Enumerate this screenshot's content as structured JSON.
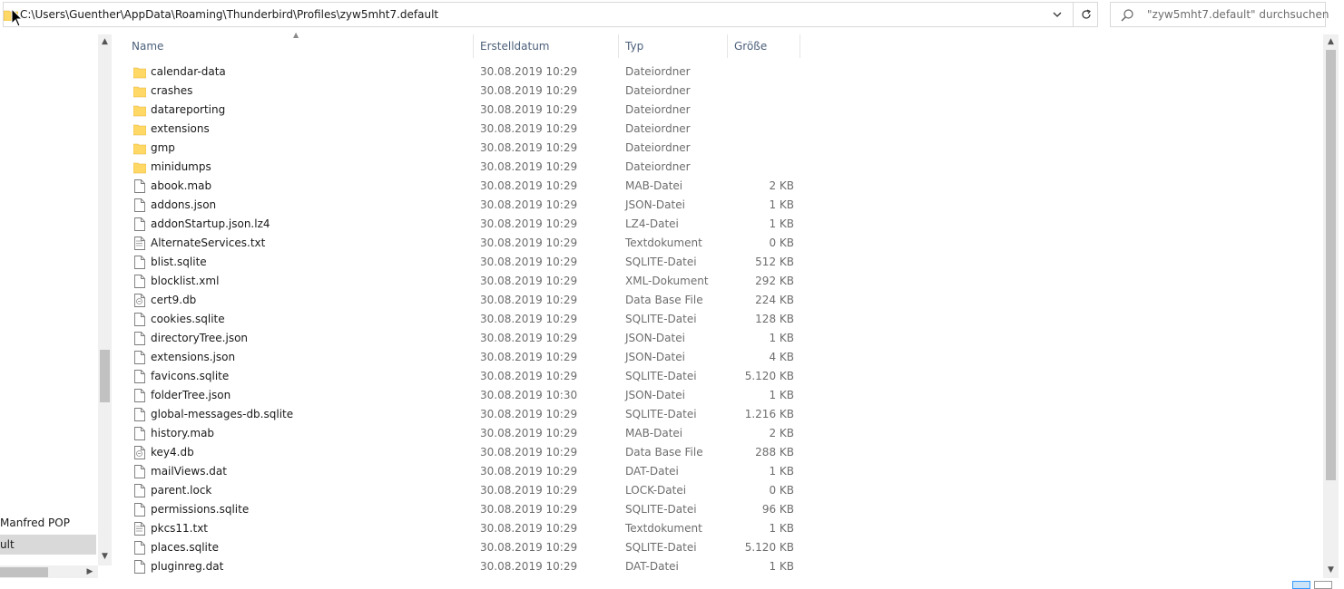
{
  "address": {
    "path": "C:\\Users\\Guenther\\AppData\\Roaming\\Thunderbird\\Profiles\\zyw5mht7.default",
    "dropdown_icon": "chevron-down-icon",
    "refresh_icon": "refresh-icon"
  },
  "search": {
    "placeholder": "\"zyw5mht7.default\" durchsuchen"
  },
  "nav": {
    "items": [
      {
        "label": "Manfred POP",
        "selected": false
      },
      {
        "label": "ult",
        "selected": true
      }
    ]
  },
  "columns": {
    "name": "Name",
    "date": "Erstelldatum",
    "type": "Typ",
    "size": "Größe"
  },
  "files": [
    {
      "name": "calendar-data",
      "date": "30.08.2019 10:29",
      "type": "Dateiordner",
      "size": "",
      "icon": "folder"
    },
    {
      "name": "crashes",
      "date": "30.08.2019 10:29",
      "type": "Dateiordner",
      "size": "",
      "icon": "folder"
    },
    {
      "name": "datareporting",
      "date": "30.08.2019 10:29",
      "type": "Dateiordner",
      "size": "",
      "icon": "folder"
    },
    {
      "name": "extensions",
      "date": "30.08.2019 10:29",
      "type": "Dateiordner",
      "size": "",
      "icon": "folder"
    },
    {
      "name": "gmp",
      "date": "30.08.2019 10:29",
      "type": "Dateiordner",
      "size": "",
      "icon": "folder"
    },
    {
      "name": "minidumps",
      "date": "30.08.2019 10:29",
      "type": "Dateiordner",
      "size": "",
      "icon": "folder"
    },
    {
      "name": "abook.mab",
      "date": "30.08.2019 10:29",
      "type": "MAB-Datei",
      "size": "2 KB",
      "icon": "file"
    },
    {
      "name": "addons.json",
      "date": "30.08.2019 10:29",
      "type": "JSON-Datei",
      "size": "1 KB",
      "icon": "file"
    },
    {
      "name": "addonStartup.json.lz4",
      "date": "30.08.2019 10:29",
      "type": "LZ4-Datei",
      "size": "1 KB",
      "icon": "file"
    },
    {
      "name": "AlternateServices.txt",
      "date": "30.08.2019 10:29",
      "type": "Textdokument",
      "size": "0 KB",
      "icon": "text"
    },
    {
      "name": "blist.sqlite",
      "date": "30.08.2019 10:29",
      "type": "SQLITE-Datei",
      "size": "512 KB",
      "icon": "file"
    },
    {
      "name": "blocklist.xml",
      "date": "30.08.2019 10:29",
      "type": "XML-Dokument",
      "size": "292 KB",
      "icon": "file"
    },
    {
      "name": "cert9.db",
      "date": "30.08.2019 10:29",
      "type": "Data Base File",
      "size": "224 KB",
      "icon": "db"
    },
    {
      "name": "cookies.sqlite",
      "date": "30.08.2019 10:29",
      "type": "SQLITE-Datei",
      "size": "128 KB",
      "icon": "file"
    },
    {
      "name": "directoryTree.json",
      "date": "30.08.2019 10:29",
      "type": "JSON-Datei",
      "size": "1 KB",
      "icon": "file"
    },
    {
      "name": "extensions.json",
      "date": "30.08.2019 10:29",
      "type": "JSON-Datei",
      "size": "4 KB",
      "icon": "file"
    },
    {
      "name": "favicons.sqlite",
      "date": "30.08.2019 10:29",
      "type": "SQLITE-Datei",
      "size": "5.120 KB",
      "icon": "file"
    },
    {
      "name": "folderTree.json",
      "date": "30.08.2019 10:30",
      "type": "JSON-Datei",
      "size": "1 KB",
      "icon": "file"
    },
    {
      "name": "global-messages-db.sqlite",
      "date": "30.08.2019 10:29",
      "type": "SQLITE-Datei",
      "size": "1.216 KB",
      "icon": "file"
    },
    {
      "name": "history.mab",
      "date": "30.08.2019 10:29",
      "type": "MAB-Datei",
      "size": "2 KB",
      "icon": "file"
    },
    {
      "name": "key4.db",
      "date": "30.08.2019 10:29",
      "type": "Data Base File",
      "size": "288 KB",
      "icon": "db"
    },
    {
      "name": "mailViews.dat",
      "date": "30.08.2019 10:29",
      "type": "DAT-Datei",
      "size": "1 KB",
      "icon": "file"
    },
    {
      "name": "parent.lock",
      "date": "30.08.2019 10:29",
      "type": "LOCK-Datei",
      "size": "0 KB",
      "icon": "file"
    },
    {
      "name": "permissions.sqlite",
      "date": "30.08.2019 10:29",
      "type": "SQLITE-Datei",
      "size": "96 KB",
      "icon": "file"
    },
    {
      "name": "pkcs11.txt",
      "date": "30.08.2019 10:29",
      "type": "Textdokument",
      "size": "1 KB",
      "icon": "text"
    },
    {
      "name": "places.sqlite",
      "date": "30.08.2019 10:29",
      "type": "SQLITE-Datei",
      "size": "5.120 KB",
      "icon": "file"
    },
    {
      "name": "pluginreg.dat",
      "date": "30.08.2019 10:29",
      "type": "DAT-Datei",
      "size": "1 KB",
      "icon": "file"
    }
  ],
  "colors": {
    "folder": "#ffd866",
    "folder_dark": "#e6b33a",
    "header_text": "#4c607a",
    "muted_text": "#6d6d6d",
    "selection": "#d9d9d9",
    "accent": "#3399ff"
  }
}
